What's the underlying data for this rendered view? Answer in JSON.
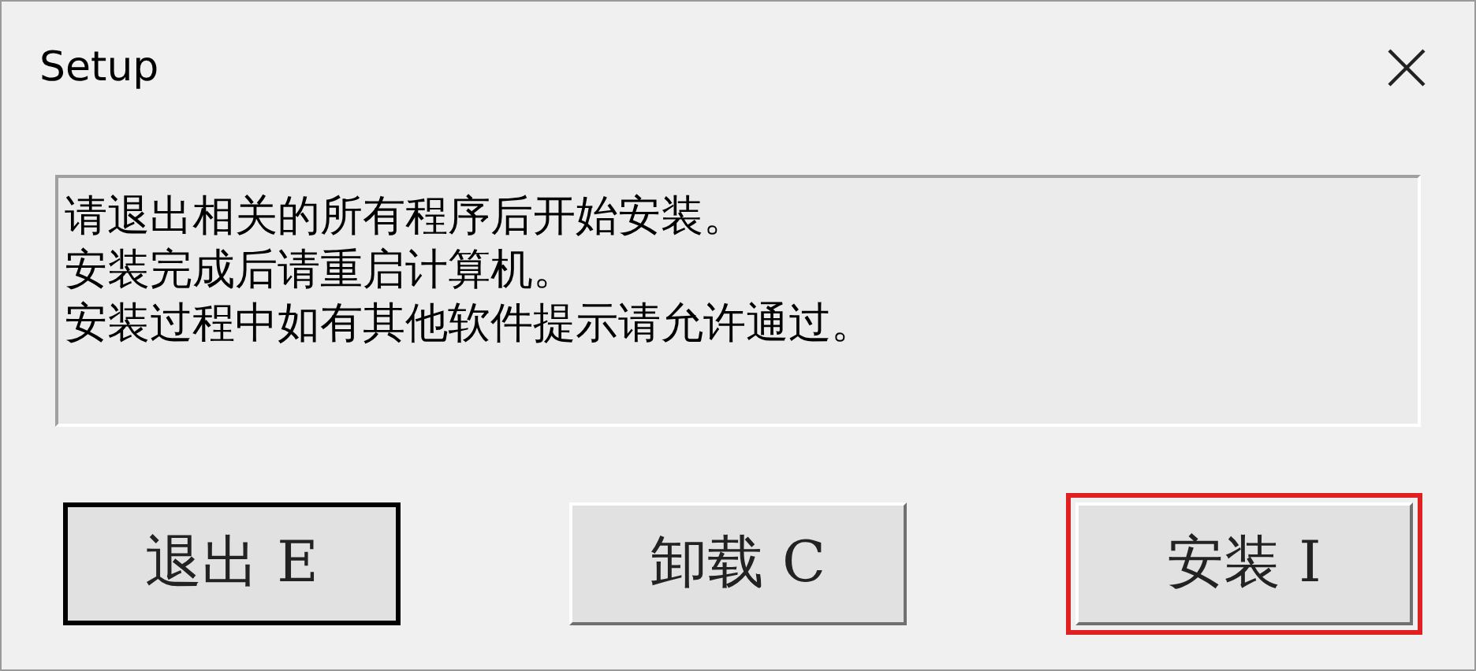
{
  "window": {
    "title": "Setup"
  },
  "message": [
    "请退出相关的所有程序后开始安装。",
    "安装完成后请重启计算机。",
    "安装过程中如有其他软件提示请允许通过。"
  ],
  "buttons": [
    {
      "label": "退出 E",
      "highlighted": false
    },
    {
      "label": "卸载 C",
      "highlighted": false
    },
    {
      "label": "安装 I",
      "highlighted": true
    }
  ]
}
